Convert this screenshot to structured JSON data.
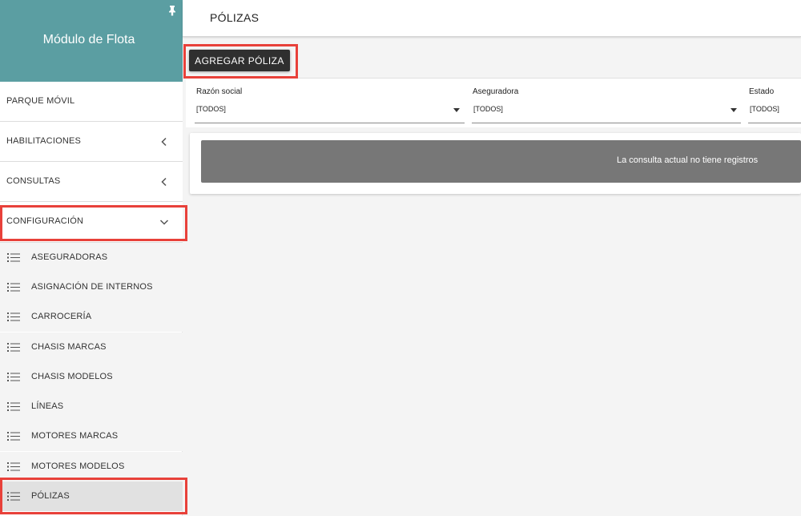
{
  "sidebar": {
    "title": "Módulo de Flota",
    "header_color": "#5b9ea2",
    "pin_icon": "pin-icon",
    "items": [
      {
        "label": "PARQUE MÓVIL"
      },
      {
        "label": "HABILITACIONES",
        "icon": "chevron-left-icon"
      },
      {
        "label": "CONSULTAS",
        "icon": "chevron-left-icon"
      },
      {
        "label": "CONFIGURACIÓN",
        "icon": "chevron-down-icon",
        "expanded": true
      }
    ],
    "subitems": [
      {
        "label": "ASEGURADORAS",
        "icon": "list-icon"
      },
      {
        "label": "ASIGNACIÓN DE INTERNOS",
        "icon": "list-icon"
      },
      {
        "label": "CARROCERÍA",
        "icon": "list-icon"
      },
      {
        "label": "CHASIS MARCAS",
        "icon": "list-icon"
      },
      {
        "label": "CHASIS MODELOS",
        "icon": "list-icon"
      },
      {
        "label": "LÍNEAS",
        "icon": "list-icon"
      },
      {
        "label": "MOTORES MARCAS",
        "icon": "list-icon"
      },
      {
        "label": "MOTORES MODELOS",
        "icon": "list-icon"
      },
      {
        "label": "PÓLIZAS",
        "icon": "list-icon",
        "active": true
      }
    ]
  },
  "header": {
    "title": "PÓLIZAS"
  },
  "toolbar": {
    "add_label": "AGREGAR PÓLIZA"
  },
  "filters": {
    "razon_social": {
      "label": "Razón social",
      "value": "[TODOS]"
    },
    "aseguradora": {
      "label": "Aseguradora",
      "value": "[TODOS]"
    },
    "estado": {
      "label": "Estado",
      "value": "[TODOS]"
    }
  },
  "results": {
    "empty_message": "La consulta actual no tiene registros"
  },
  "colors": {
    "highlight": "#e8413a",
    "button": "#2f2f2f",
    "empty_banner": "#777777"
  }
}
